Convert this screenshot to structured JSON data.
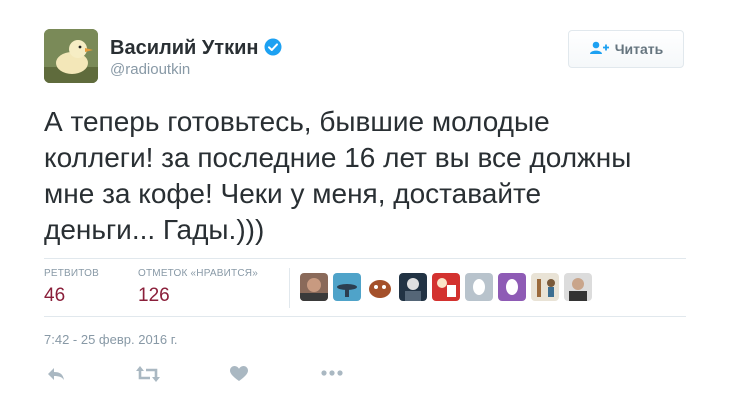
{
  "user": {
    "display_name": "Василий Уткин",
    "username": "@radioutkin",
    "verified": true,
    "avatar_icon": "duckling-avatar"
  },
  "follow_button": {
    "label": "Читать",
    "icon": "add-user-icon"
  },
  "tweet": {
    "text": "А теперь готовьтесь, бывшие молодые\nколлеги! за последние 16 лет вы все должны\nмне за кофе! Чеки у меня, доставайте\nденьги... Гады.)))"
  },
  "stats": {
    "retweets_label": "РЕТВИТОВ",
    "retweets_value": "46",
    "likes_label": "ОТМЕТОК «НРАВИТСЯ»",
    "likes_value": "126"
  },
  "likers": [
    {
      "icon": "liker-avatar-1"
    },
    {
      "icon": "liker-avatar-2"
    },
    {
      "icon": "liker-avatar-3"
    },
    {
      "icon": "liker-avatar-4"
    },
    {
      "icon": "liker-avatar-5"
    },
    {
      "icon": "default-egg-avatar"
    },
    {
      "icon": "default-egg-avatar"
    },
    {
      "icon": "liker-avatar-8"
    },
    {
      "icon": "liker-avatar-9"
    }
  ],
  "timestamp": "7:42 - 25 февр. 2016 г.",
  "actions": [
    "reply-icon",
    "retweet-icon",
    "like-icon",
    "more-icon"
  ],
  "colors": {
    "stat_value": "#8a1f3a",
    "secondary_text": "#8899a6",
    "primary_text": "#292f33",
    "verified": "#1da1f2",
    "action_icon": "#aab8c2"
  }
}
